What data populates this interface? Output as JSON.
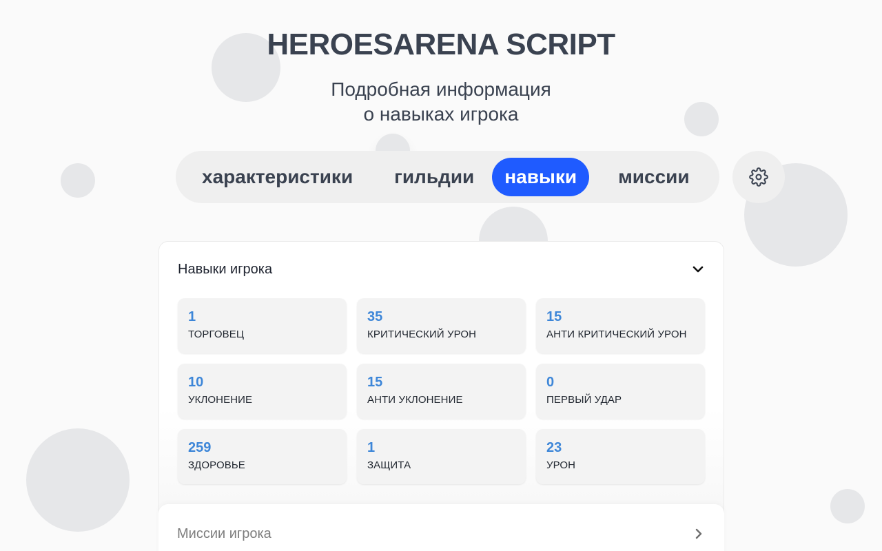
{
  "header": {
    "title": "HEROESARENA SCRIPT",
    "subtitle_line1": "Подробная информация",
    "subtitle_line2": "о навыках игрока"
  },
  "tabs": [
    {
      "label": "характеристики",
      "active": false
    },
    {
      "label": "гильдии",
      "active": false
    },
    {
      "label": "навыки",
      "active": true
    },
    {
      "label": "миссии",
      "active": false
    }
  ],
  "settings": {
    "icon": "gear-icon"
  },
  "skills_panel": {
    "title": "Навыки игрока",
    "toggle_icon": "chevron-down-icon",
    "cards": [
      {
        "value": "1",
        "label": "ТОРГОВЕЦ"
      },
      {
        "value": "35",
        "label": "КРИТИЧЕСКИЙ УРОН"
      },
      {
        "value": "15",
        "label": "АНТИ КРИТИЧЕСКИЙ УРОН"
      },
      {
        "value": "10",
        "label": "УКЛОНЕНИЕ"
      },
      {
        "value": "15",
        "label": "АНТИ УКЛОНЕНИЕ"
      },
      {
        "value": "0",
        "label": "ПЕРВЫЙ УДАР"
      },
      {
        "value": "259",
        "label": "ЗДОРОВЬЕ"
      },
      {
        "value": "1",
        "label": "ЗАЩИТА"
      },
      {
        "value": "23",
        "label": "УРОН"
      }
    ]
  },
  "missions_panel": {
    "title": "Миссии игрока",
    "toggle_icon": "chevron-right-icon"
  },
  "colors": {
    "accent": "#1f5bff",
    "value": "#3d86d8",
    "text": "#3a4250"
  }
}
